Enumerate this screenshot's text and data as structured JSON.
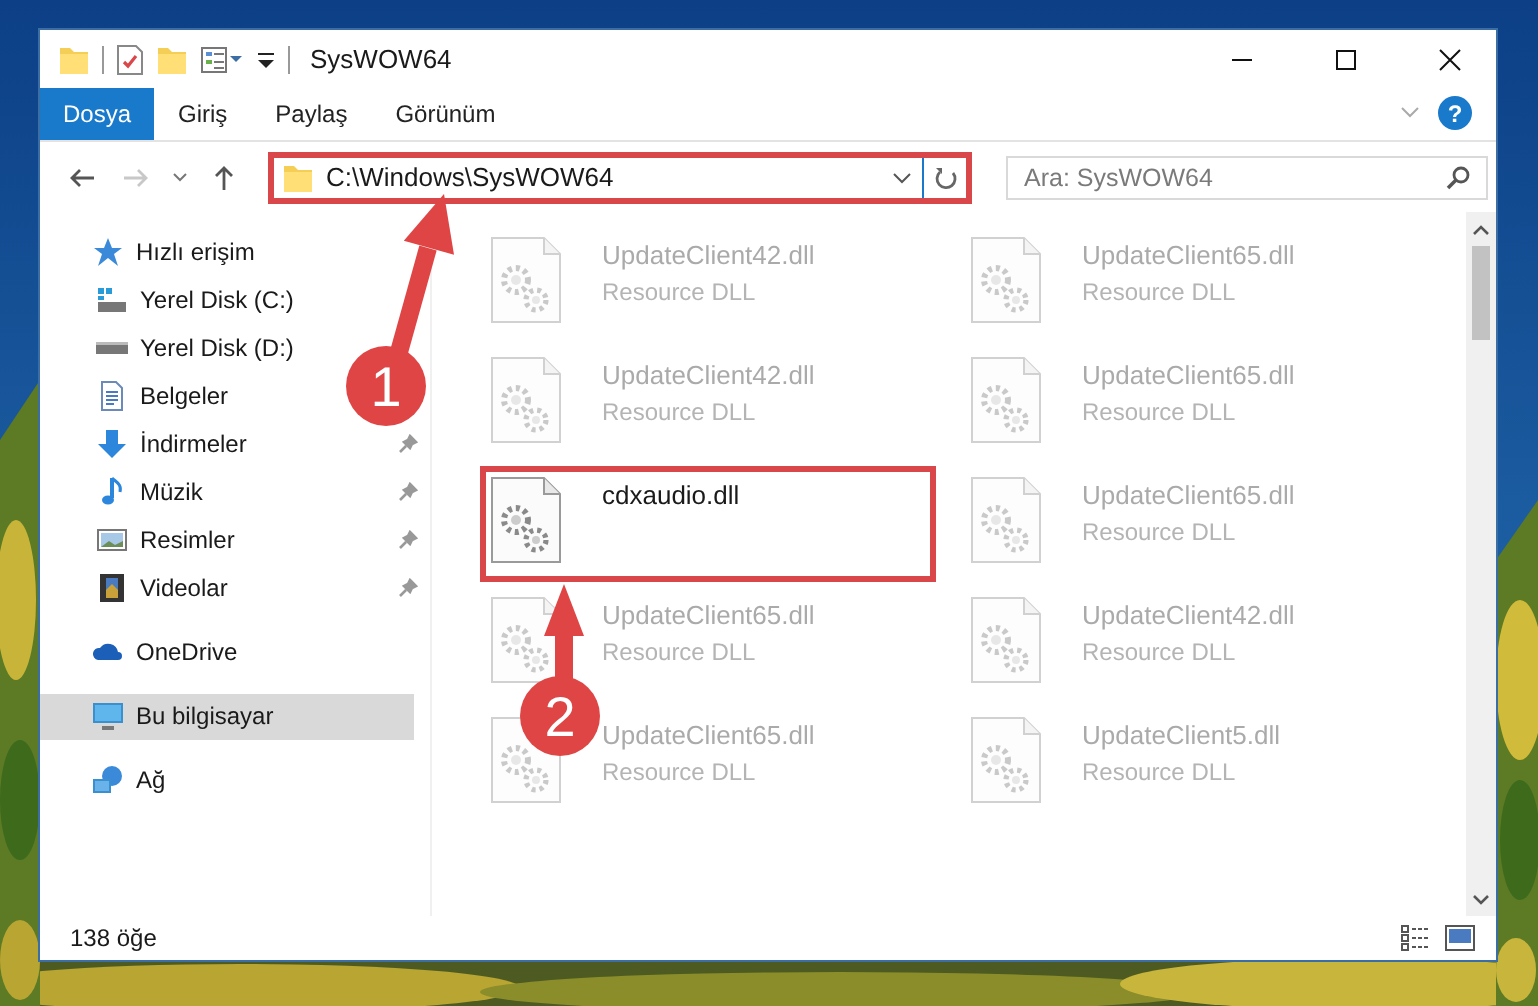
{
  "window": {
    "title": "SysWOW64"
  },
  "ribbon_tabs": [
    {
      "label": "Dosya",
      "selected": true
    },
    {
      "label": "Giriş",
      "selected": false
    },
    {
      "label": "Paylaş",
      "selected": false
    },
    {
      "label": "Görünüm",
      "selected": false
    }
  ],
  "help": "?",
  "address": {
    "path": "C:\\Windows\\SysWOW64",
    "highlighted": true
  },
  "search": {
    "placeholder": "Ara: SysWOW64"
  },
  "navigation": [
    {
      "label": "Hızlı erişim",
      "kind": "star",
      "selected": false,
      "children": [
        {
          "label": "Yerel Disk (C:)",
          "kind": "systemdrive",
          "pinned": false,
          "selected": false
        },
        {
          "label": "Yerel Disk (D:)",
          "kind": "drive",
          "pinned": false,
          "selected": false
        },
        {
          "label": "Belgeler",
          "kind": "documents",
          "pinned": false,
          "selected": false
        },
        {
          "label": "İndirmeler",
          "kind": "downloads",
          "pinned": true,
          "selected": false
        },
        {
          "label": "Müzik",
          "kind": "music",
          "pinned": true,
          "selected": false
        },
        {
          "label": "Resimler",
          "kind": "pictures",
          "pinned": true,
          "selected": false
        },
        {
          "label": "Videolar",
          "kind": "videos",
          "pinned": true,
          "selected": false
        }
      ]
    },
    {
      "label": "OneDrive",
      "kind": "cloud",
      "selected": false
    },
    {
      "label": "Bu bilgisayar",
      "kind": "computer",
      "selected": true
    },
    {
      "label": "Ağ",
      "kind": "network",
      "selected": false
    }
  ],
  "files": [
    {
      "name": "UpdateClient42.dll",
      "type": "Resource DLL",
      "highlighted": false
    },
    {
      "name": "UpdateClient65.dll",
      "type": "Resource DLL",
      "highlighted": false
    },
    {
      "name": "UpdateClient42.dll",
      "type": "Resource DLL",
      "highlighted": false
    },
    {
      "name": "UpdateClient65.dll",
      "type": "Resource DLL",
      "highlighted": false
    },
    {
      "name": "cdxaudio.dll",
      "highlighted": true
    },
    {
      "name": "UpdateClient65.dll",
      "type": "Resource DLL",
      "highlighted": false
    },
    {
      "name": "UpdateClient65.dll",
      "type": "Resource DLL",
      "highlighted": false
    },
    {
      "name": "UpdateClient42.dll",
      "type": "Resource DLL",
      "highlighted": false
    },
    {
      "name": "UpdateClient65.dll",
      "type": "Resource DLL",
      "highlighted": false
    },
    {
      "name": "UpdateClient5.dll",
      "type": "Resource DLL",
      "highlighted": false
    }
  ],
  "status_bar": {
    "item_count": "138 öğe"
  },
  "annotations": [
    {
      "label": "1"
    },
    {
      "label": "2"
    }
  ]
}
